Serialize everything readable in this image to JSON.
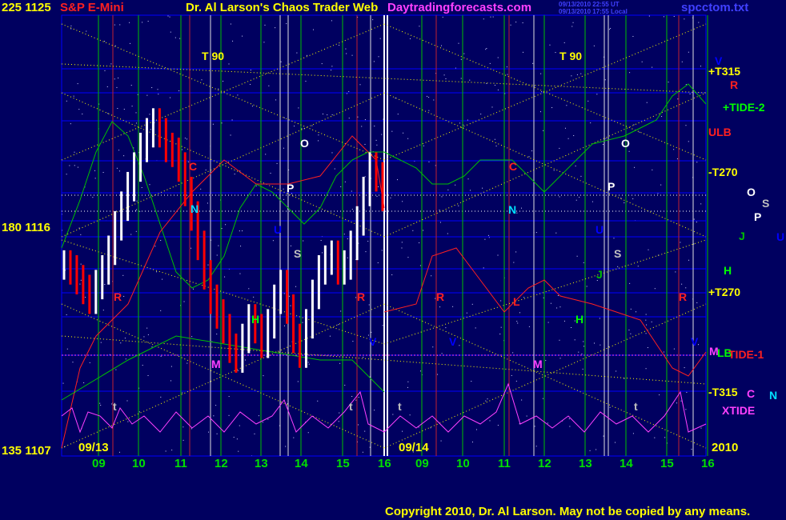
{
  "header": {
    "left_axis": "225  1125",
    "instrument": "S&P E-Mini",
    "title": "Dr. Al Larson's Chaos Trader Web",
    "site": "Daytradingforecasts.com",
    "stamp1": "09/13/2010 22:55 UT",
    "stamp2": "09/13/2010 17:55 Local",
    "file": "spcctom.txt"
  },
  "left_axis": {
    "mid": "180  1116",
    "bottom": "135  1107"
  },
  "date_labels": {
    "day1": "09/13",
    "day2": "09/14",
    "year": "2010"
  },
  "x_ticks": [
    "09",
    "10",
    "11",
    "12",
    "13",
    "14",
    "15",
    "16",
    "09",
    "10",
    "11",
    "12",
    "13",
    "14",
    "15",
    "16"
  ],
  "right_labels": {
    "t315_plus": "+T315",
    "r": "R",
    "tide2": "+TIDE-2",
    "ulb": "ULB",
    "t270_minus": "-T270",
    "o": "O",
    "s": "S",
    "p": "P",
    "j": "J",
    "u": "U",
    "h": "H",
    "t270_plus": "+T270",
    "m": "M",
    "lb": "LB",
    "tide1": "TIDE-1",
    "t315_minus": "-T315",
    "c": "C",
    "n": "N",
    "xtide": "XTIDE"
  },
  "planet_markers": {
    "t90a": "T  90",
    "t90b": "T  90",
    "c": "C",
    "n": "N",
    "o": "O",
    "p": "P",
    "s": "S",
    "u": "U",
    "r": "R",
    "h": "H",
    "m": "M",
    "v": "V",
    "j": "J",
    "t": "t",
    "l": "L"
  },
  "copyright": "Copyright 2010, Dr. Al Larson. May not be copied by any means.",
  "colors": {
    "background": "#000060",
    "grid": "#0000ff",
    "price_up": "#ffffff",
    "price_down": "#ff0000",
    "red_line": "#ff2020",
    "green_line": "#00c000",
    "yellow_dotted": "#ffff00",
    "magenta": "#ff40ff"
  },
  "chart_data": {
    "type": "bar",
    "title": "S&P E-Mini",
    "ylim": [
      1107,
      1125
    ],
    "y_ticks": [
      1107,
      1116,
      1125
    ],
    "x_ticks": [
      "09",
      "10",
      "11",
      "12",
      "13",
      "14",
      "15",
      "16",
      "09",
      "10",
      "11",
      "12",
      "13",
      "14",
      "15",
      "16"
    ],
    "close_series": [
      1114.8,
      1114.6,
      1114.2,
      1113.8,
      1113.4,
      1114.0,
      1114.6,
      1115.4,
      1116.4,
      1117.2,
      1118.0,
      1118.8,
      1119.6,
      1120.2,
      1120.6,
      1120.2,
      1119.6,
      1119.4,
      1118.8,
      1117.8,
      1116.8,
      1115.6,
      1114.4,
      1113.4,
      1112.8,
      1112.2,
      1111.4,
      1111.0,
      1111.8,
      1112.6,
      1112.2,
      1111.6,
      1112.4,
      1113.4,
      1114.0,
      1113.0,
      1111.8,
      1111.2,
      1112.4,
      1113.6,
      1114.6,
      1115.0,
      1115.2,
      1114.6,
      1114.8,
      1115.6,
      1116.6,
      1117.8,
      1118.8,
      1118.4,
      1117.6
    ]
  }
}
